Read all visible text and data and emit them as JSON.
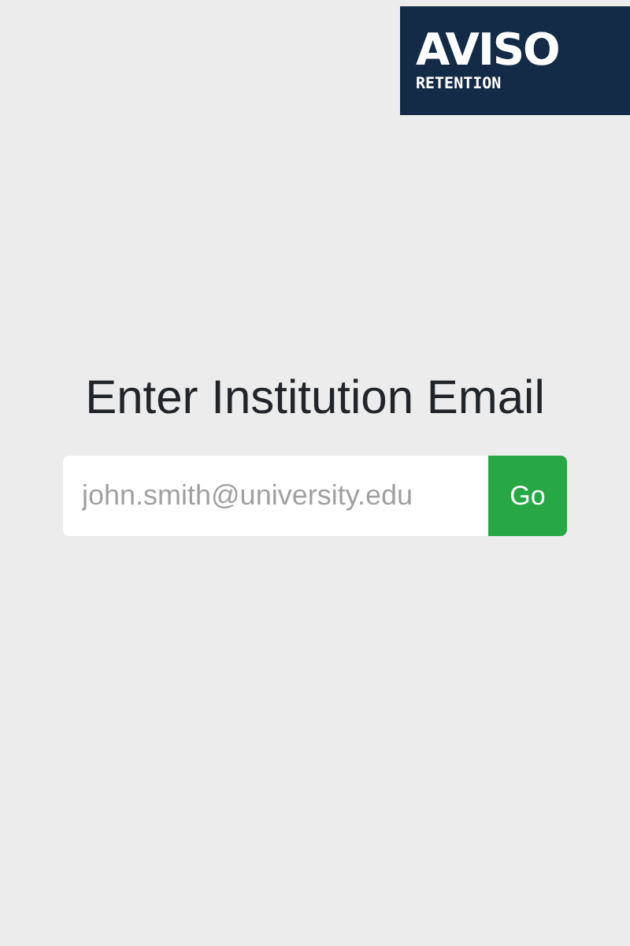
{
  "logo": {
    "name": "AVISO",
    "tagline": "RETENTION"
  },
  "heading": "Enter Institution Email",
  "email": {
    "placeholder": "john.smith@university.edu"
  },
  "button": "Go"
}
